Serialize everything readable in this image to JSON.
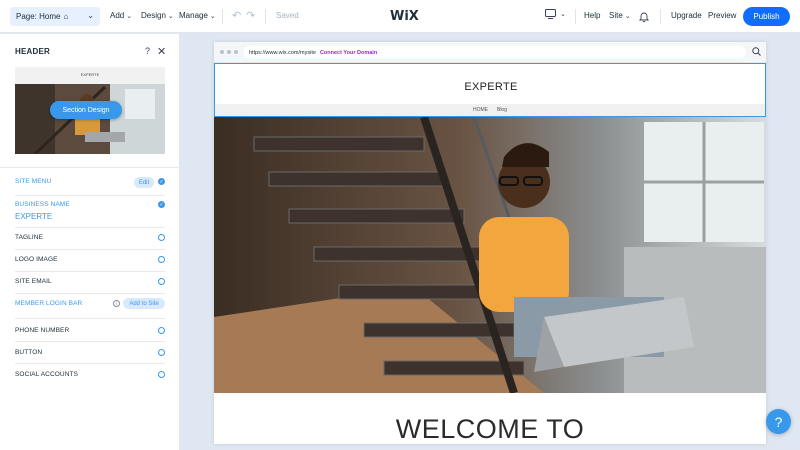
{
  "topbar": {
    "page_select": "Page: Home",
    "menu": {
      "add": "Add",
      "design": "Design",
      "manage": "Manage"
    },
    "status": "Saved",
    "logo": "WiX",
    "right": {
      "help": "Help",
      "site": "Site",
      "upgrade": "Upgrade",
      "preview": "Preview",
      "publish": "Publish"
    },
    "icons": [
      "home-icon",
      "chevron-down-icon",
      "undo-icon",
      "redo-icon",
      "desktop-icon",
      "bell-icon"
    ]
  },
  "panel": {
    "title": "HEADER",
    "help": "?",
    "section_design": "Section Design",
    "thumb_logo": "EXPERTE",
    "items": [
      {
        "label": "SITE MENU",
        "action": "Edit",
        "state": "checked"
      },
      {
        "label": "BUSINESS NAME",
        "value": "EXPERTE",
        "state": "checked"
      },
      {
        "label": "TAGLINE",
        "state": "unchecked"
      },
      {
        "label": "LOGO IMAGE",
        "state": "unchecked"
      },
      {
        "label": "SITE EMAIL",
        "state": "unchecked"
      },
      {
        "label": "MEMBER LOGIN BAR",
        "action": "Add to Site",
        "info": "i"
      },
      {
        "label": "PHONE NUMBER",
        "state": "unchecked"
      },
      {
        "label": "BUTTON",
        "state": "unchecked"
      },
      {
        "label": "SOCIAL ACCOUNTS",
        "state": "unchecked"
      }
    ]
  },
  "canvas": {
    "url": "https://www.wix.com/mysite",
    "connect": "Connect Your Domain",
    "site_logo": "EXPERTE",
    "nav": [
      "HOME",
      "Blog"
    ],
    "welcome": "WELCOME TO"
  },
  "help_bubble": "?",
  "colors": {
    "accent": "#116dff",
    "panel_blue": "#3899ec",
    "canvas_bg": "#dfe7f2"
  }
}
